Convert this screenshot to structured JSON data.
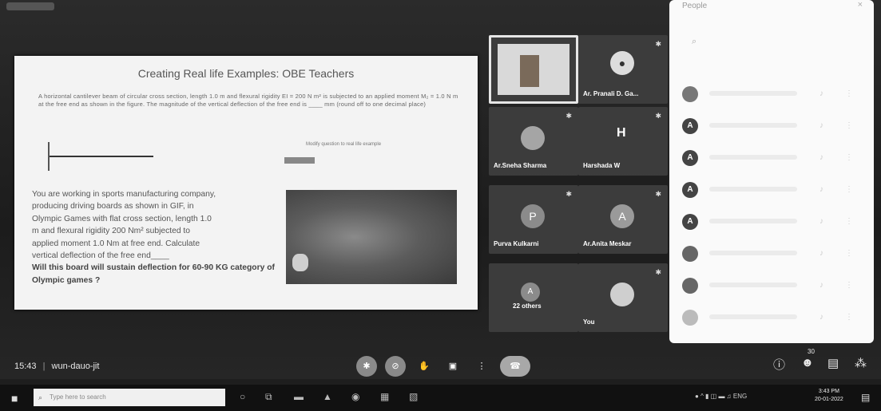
{
  "slide": {
    "title": "Creating Real life Examples: OBE Teachers",
    "problem": "A horizontal cantilever beam of circular cross section, length 1.0 m and flexural rigidity EI = 200 N m² is subjected to an applied moment M₂ = 1.0 N m at the free end as shown in the figure. The magnitude of the vertical deflection of the free end is ____ mm (round off to one decimal place)",
    "modify_label": "Modify question to real life example",
    "body_lines": [
      "You are working in sports manufacturing company,",
      "producing driving boards as shown in GIF, in",
      "Olympic Games with flat cross section, length 1.0",
      "m and flexural rigidity 200 Nm² subjected to",
      "applied moment 1.0 Nm at free end. Calculate",
      "vertical deflection of the free end____"
    ],
    "body_last": "Will this board will sustain deflection for 60-90 KG category of Olympic games ?"
  },
  "tiles": [
    {
      "name": "",
      "initial": "",
      "mic": ""
    },
    {
      "name": "Ar. Pranali D. Ga...",
      "initial": "",
      "mic": "✱"
    },
    {
      "name": "Ar.Sneha Sharma",
      "initial": "",
      "mic": "✱"
    },
    {
      "name": "Harshada W",
      "initial": "H",
      "mic": "✱"
    },
    {
      "name": "Purva Kulkarni",
      "initial": "P",
      "mic": "✱"
    },
    {
      "name": "Ar.Anita Meskar",
      "initial": "A",
      "mic": "✱"
    },
    {
      "name": "22 others",
      "initial": "A",
      "mic": ""
    },
    {
      "name": "You",
      "initial": "",
      "mic": "✱"
    }
  ],
  "panel": {
    "title": "People",
    "close": "×",
    "search_icon": "search-icon",
    "rows": [
      {
        "initial": ""
      },
      {
        "initial": "A"
      },
      {
        "initial": "A"
      },
      {
        "initial": "A"
      },
      {
        "initial": "A"
      },
      {
        "initial": ""
      },
      {
        "initial": ""
      },
      {
        "initial": ""
      }
    ]
  },
  "meeting": {
    "time": "15:43",
    "separator": "|",
    "code": "wun-dauo-jit"
  },
  "controls": {
    "participant_count": "30"
  },
  "taskbar": {
    "search_placeholder": "Type here to search",
    "lang": "ENG",
    "time": "3:43 PM",
    "date": "20-01-2022"
  }
}
